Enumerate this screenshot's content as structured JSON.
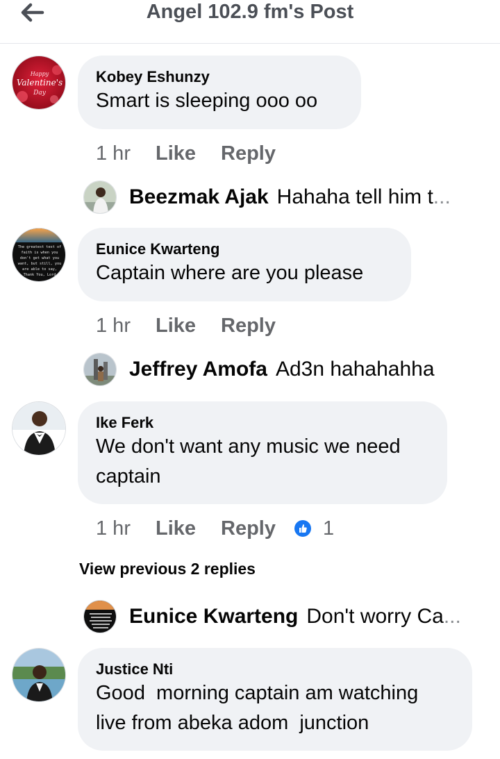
{
  "header": {
    "title": "Angel 102.9 fm's Post",
    "back_icon": "arrow-left-icon"
  },
  "comments": [
    {
      "author": "Kobey Eshunzy",
      "text": "Smart is sleeping ooo oo",
      "time": "1 hr",
      "like": "Like",
      "reply": "Reply",
      "avatar": {
        "kind": "valentine",
        "line1": "Happy",
        "line2": "Valentine's",
        "line3": "Day",
        "colors": [
          "#b80f24",
          "#e0203a"
        ]
      }
    },
    {
      "author": "Eunice Kwarteng",
      "text": "Captain where are you please",
      "time": "1 hr",
      "like": "Like",
      "reply": "Reply",
      "avatar": {
        "kind": "quote",
        "lines": [
          "The greatest test of",
          "faith is when you",
          "don't get what you",
          "want, but still, you",
          "are able to say,",
          "Thank You, Lord"
        ]
      }
    },
    {
      "author": "Ike Ferk",
      "text_lines": [
        "We don't want any music we need",
        "captain"
      ],
      "time": "1 hr",
      "like": "Like",
      "reply": "Reply",
      "reaction_icon": "thumbs-up-icon",
      "reaction_count": "1",
      "avatar": {
        "kind": "person"
      }
    },
    {
      "author": "Justice Nti",
      "text_lines": [
        "Good  morning captain am watching",
        "live from abeka adom  junction"
      ],
      "avatar": {
        "kind": "person-outdoor"
      }
    }
  ],
  "replies": [
    {
      "author": "Beezmak Ajak",
      "text": "Hahaha tell him t",
      "ellipsis": "..."
    },
    {
      "author": "Jeffrey Amofa",
      "text": "Ad3n hahahahha"
    },
    {
      "author": "Eunice Kwarteng",
      "text": "Don't worry Ca",
      "ellipsis": "..."
    }
  ],
  "view_previous": "View previous 2 replies",
  "colors": {
    "bubble": "#f0f2f5",
    "secondary_text": "#65676b",
    "like_blue": "#1877f2"
  }
}
